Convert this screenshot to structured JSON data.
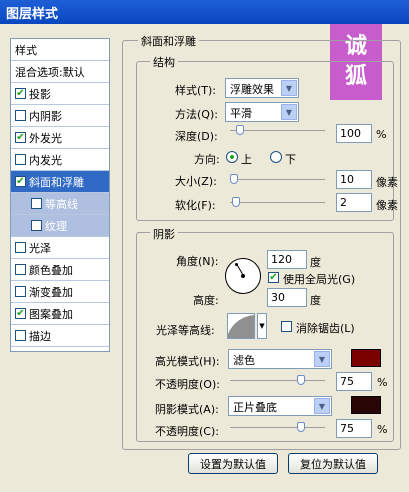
{
  "window": {
    "title": "图层样式"
  },
  "watermark": {
    "line1": "诚",
    "line2": "狐"
  },
  "style_list": {
    "header": "样式",
    "blend": "混合选项:默认",
    "items": [
      {
        "label": "投影",
        "checked": true
      },
      {
        "label": "内阴影",
        "checked": false
      },
      {
        "label": "外发光",
        "checked": true
      },
      {
        "label": "内发光",
        "checked": false
      },
      {
        "label": "斜面和浮雕",
        "checked": true,
        "selected": true
      },
      {
        "label": "等高线",
        "checked": false,
        "sub": true
      },
      {
        "label": "纹理",
        "checked": false,
        "sub": true
      },
      {
        "label": "光泽",
        "checked": false
      },
      {
        "label": "颜色叠加",
        "checked": false
      },
      {
        "label": "渐变叠加",
        "checked": false
      },
      {
        "label": "图案叠加",
        "checked": true
      },
      {
        "label": "描边",
        "checked": false
      }
    ]
  },
  "bevel": {
    "title": "斜面和浮雕",
    "structure": {
      "title": "结构",
      "style_label": "样式(T):",
      "style_value": "浮雕效果",
      "technique_label": "方法(Q):",
      "technique_value": "平滑",
      "depth_label": "深度(D):",
      "depth_value": "100",
      "depth_unit": "%",
      "depth_fraction": 0.1,
      "direction_label": "方向:",
      "direction_up": "上",
      "direction_down": "下",
      "size_label": "大小(Z):",
      "size_value": "10",
      "size_unit": "像素",
      "size_fraction": 0.04,
      "soften_label": "软化(F):",
      "soften_value": "2",
      "soften_unit": "像素",
      "soften_fraction": 0.06
    },
    "shading": {
      "title": "阴影",
      "angle_label": "角度(N):",
      "angle_value": "120",
      "angle_unit": "度",
      "global_light_label": "使用全局光(G)",
      "altitude_label": "高度:",
      "altitude_value": "30",
      "altitude_unit": "度",
      "gloss_label": "光泽等高线:",
      "antialias_label": "消除锯齿(L)",
      "highlight_mode_label": "高光模式(H):",
      "highlight_mode_value": "滤色",
      "highlight_color": "#7a0000",
      "highlight_opacity_label": "不透明度(O):",
      "highlight_opacity_value": "75",
      "highlight_opacity_unit": "%",
      "highlight_opacity_fraction": 0.75,
      "shadow_mode_label": "阴影模式(A):",
      "shadow_mode_value": "正片叠底",
      "shadow_color": "#2a0505",
      "shadow_opacity_label": "不透明度(C):",
      "shadow_opacity_value": "75",
      "shadow_opacity_unit": "%",
      "shadow_opacity_fraction": 0.75
    }
  },
  "buttons": {
    "make_default": "设置为默认值",
    "reset_default": "复位为默认值"
  }
}
